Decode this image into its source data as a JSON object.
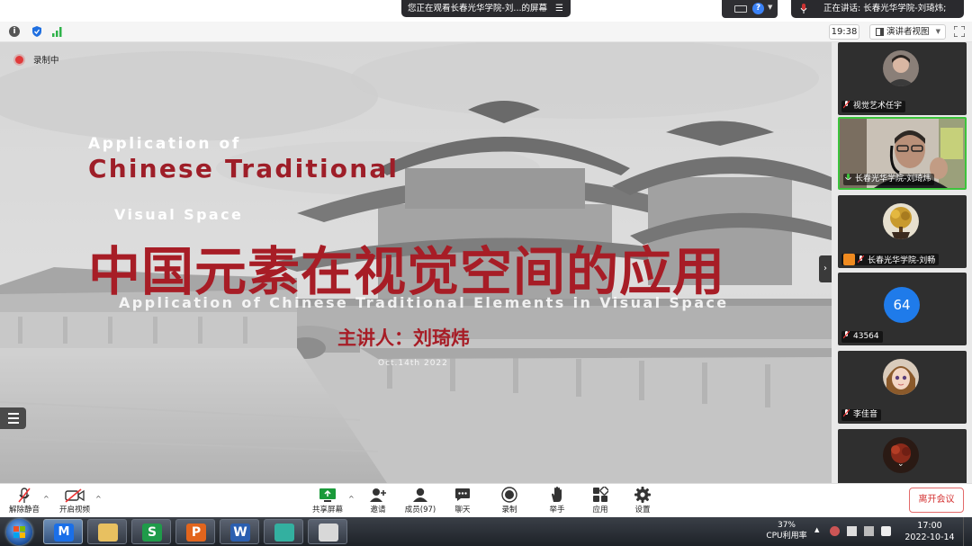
{
  "top": {
    "viewing_text": "您正在观看长春光华学院-刘...的屏幕",
    "speaking_text": "正在讲话: 长春光华学院-刘琦炜;"
  },
  "infobar": {
    "timer": "19:38",
    "view_mode": "演讲者视图"
  },
  "recording": {
    "label": "录制中"
  },
  "slide": {
    "line_application_of": "Application of",
    "line_chinese_traditional": "Chinese Traditional",
    "line_visual_space": "Visual Space",
    "title_cn": "中国元素在视觉空间的应用",
    "subtitle_en": "Application of Chinese Traditional Elements in Visual Space",
    "speaker": "主讲人：刘琦炜",
    "date": "Oct.14th 2022"
  },
  "participants": [
    {
      "name": "视觉艺术任宇",
      "avatar": "portrait-photo",
      "muted": true
    },
    {
      "name": "长春光华学院-刘琦炜",
      "avatar": "live-video",
      "muted": false,
      "active_speaker": true
    },
    {
      "name": "长春光华学院-刘畅",
      "avatar": "plant-photo",
      "muted": true
    },
    {
      "name": "43564",
      "avatar_text": "64",
      "muted": true
    },
    {
      "name": "李佳音",
      "avatar": "doll-photo",
      "muted": true
    },
    {
      "name": "",
      "avatar": "flower-photo",
      "muted": true
    }
  ],
  "toolbar": {
    "unmute": "解除静音",
    "start_video": "开启视频",
    "share_screen": "共享屏幕",
    "invite": "邀请",
    "members": "成员(97)",
    "chat": "聊天",
    "record": "录制",
    "raise_hand": "举手",
    "apps": "应用",
    "settings": "设置",
    "leave": "离开会议"
  },
  "taskbar": {
    "cpu_percent": "37%",
    "cpu_label": "CPU利用率",
    "time": "17:00",
    "date": "2022-10-14"
  },
  "colors": {
    "slide_red": "#a71d26",
    "active_green": "#3cc43c",
    "avatar_blue": "#1f7bea",
    "leave_red": "#d43131"
  }
}
